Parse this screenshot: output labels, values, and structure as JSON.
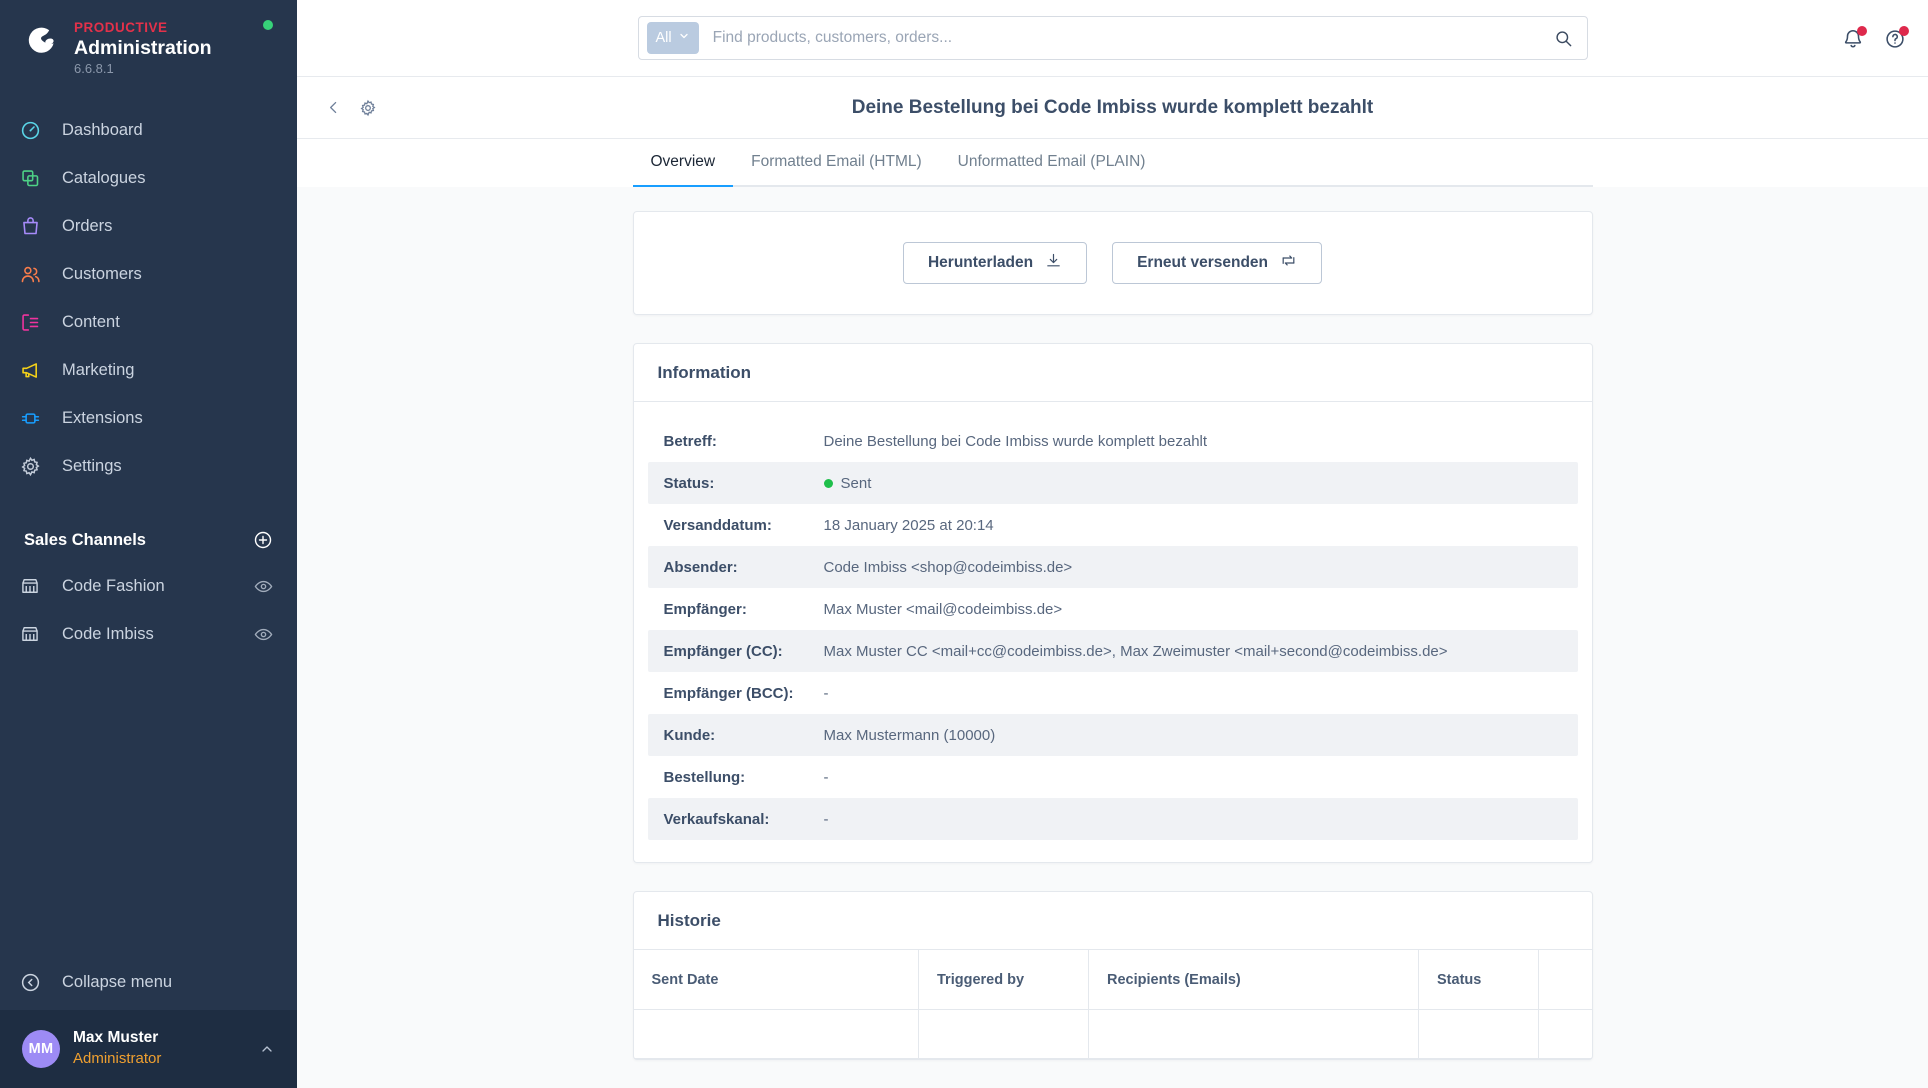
{
  "brand": {
    "logo_icon": "shopware-logo-icon",
    "eyebrow": "PRODUCTIVE",
    "name": "Administration",
    "version": "6.6.8.1",
    "status_dot_color": "#37d279",
    "eyebrow_color": "#e4314a"
  },
  "sidebar": {
    "items": [
      {
        "label": "Dashboard",
        "icon": "dashboard-icon",
        "color": "#5ad6e8"
      },
      {
        "label": "Catalogues",
        "icon": "catalogues-icon",
        "color": "#4ed286"
      },
      {
        "label": "Orders",
        "icon": "orders-icon",
        "color": "#a78bfa"
      },
      {
        "label": "Customers",
        "icon": "customers-icon",
        "color": "#f97d4b"
      },
      {
        "label": "Content",
        "icon": "content-icon",
        "color": "#f0339e"
      },
      {
        "label": "Marketing",
        "icon": "marketing-icon",
        "color": "#f5d218"
      },
      {
        "label": "Extensions",
        "icon": "extensions-icon",
        "color": "#189eff"
      },
      {
        "label": "Settings",
        "icon": "settings-gear-icon",
        "color": "#c3ccd9"
      }
    ],
    "sales_channels": {
      "title": "Sales Channels",
      "add_icon": "plus-circle-icon",
      "items": [
        {
          "label": "Code Fashion",
          "icon": "storefront-icon",
          "action_icon": "eye-icon"
        },
        {
          "label": "Code Imbiss",
          "icon": "storefront-icon",
          "action_icon": "eye-icon"
        }
      ]
    },
    "collapse": {
      "label": "Collapse menu",
      "icon": "chevron-left-circle-icon"
    },
    "user": {
      "initials": "MM",
      "name": "Max Muster",
      "role": "Administrator",
      "caret_icon": "chevron-up-icon",
      "avatar_color": "#9d8bf5",
      "role_color": "#f0a030"
    }
  },
  "topbar": {
    "scope_label": "All",
    "scope_caret_icon": "chevron-down-icon",
    "search_placeholder": "Find products, customers, orders...",
    "search_value": "",
    "search_icon": "search-icon",
    "notifications_icon": "bell-icon",
    "help_icon": "question-circle-icon",
    "badge_color": "#de294c"
  },
  "page_header": {
    "back_icon": "chevron-left-icon",
    "settings_icon": "gear-icon",
    "title": "Deine Bestellung bei Code Imbiss wurde komplett bezahlt"
  },
  "tabs": [
    {
      "label": "Overview",
      "active": true
    },
    {
      "label": "Formatted Email (HTML)",
      "active": false
    },
    {
      "label": "Unformatted Email (PLAIN)",
      "active": false
    }
  ],
  "tab_accent_color": "#189eff",
  "actions": {
    "download": {
      "label": "Herunterladen",
      "icon": "download-icon"
    },
    "resend": {
      "label": "Erneut versenden",
      "icon": "resend-loop-icon"
    }
  },
  "information": {
    "title": "Information",
    "rows": [
      {
        "label": "Betreff:",
        "value": "Deine Bestellung bei Code Imbiss wurde komplett bezahlt",
        "striped": false,
        "status": false
      },
      {
        "label": "Status:",
        "value": "Sent",
        "striped": true,
        "status": true,
        "status_color": "#1fbf4b"
      },
      {
        "label": "Versanddatum:",
        "value": "18 January 2025 at 20:14",
        "striped": false,
        "status": false
      },
      {
        "label": "Absender:",
        "value": "Code Imbiss <shop@codeimbiss.de>",
        "striped": true,
        "status": false
      },
      {
        "label": "Empfänger:",
        "value": "Max Muster <mail@codeimbiss.de>",
        "striped": false,
        "status": false
      },
      {
        "label": "Empfänger (CC):",
        "value": "Max Muster CC <mail+cc@codeimbiss.de>, Max Zweimuster <mail+second@codeimbiss.de>",
        "striped": true,
        "status": false
      },
      {
        "label": "Empfänger (BCC):",
        "value": "-",
        "striped": false,
        "status": false
      },
      {
        "label": "Kunde:",
        "value": "Max Mustermann (10000)",
        "striped": true,
        "status": false
      },
      {
        "label": "Bestellung:",
        "value": "-",
        "striped": false,
        "status": false
      },
      {
        "label": "Verkaufskanal:",
        "value": "-",
        "striped": true,
        "status": false
      }
    ]
  },
  "history": {
    "title": "Historie",
    "columns": [
      "Sent Date",
      "Triggered by",
      "Recipients (Emails)",
      "Status",
      ""
    ],
    "rows": []
  }
}
